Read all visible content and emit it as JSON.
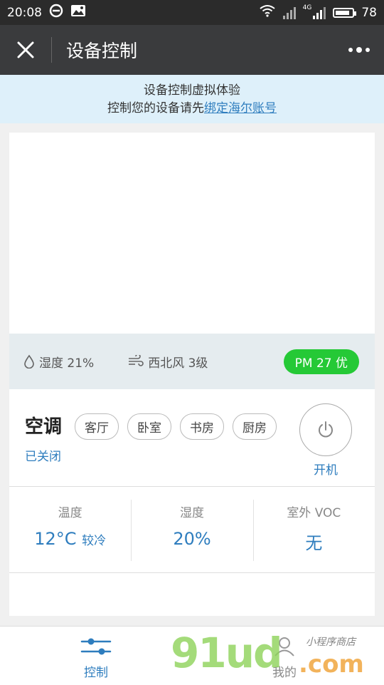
{
  "status_bar": {
    "time": "20:08",
    "battery": "78",
    "network": "4G"
  },
  "header": {
    "title": "设备控制"
  },
  "banner": {
    "line1": "设备控制虚拟体验",
    "line2_prefix": "控制您的设备请先",
    "line2_link": "绑定海尔账号"
  },
  "environment": {
    "humidity": "湿度 21%",
    "wind": "西北风 3级",
    "pm": "PM 27 优"
  },
  "device": {
    "name": "空调",
    "status": "已关闭",
    "rooms": [
      "客厅",
      "卧室",
      "书房",
      "厨房"
    ],
    "power_label": "开机"
  },
  "stats": [
    {
      "label": "温度",
      "value": "12°C",
      "note": "较冷"
    },
    {
      "label": "湿度",
      "value": "20%"
    },
    {
      "label": "室外 VOC",
      "value": "无"
    }
  ],
  "tabbar": {
    "control_label": "控制",
    "mine_label": "我的"
  },
  "watermark": {
    "main": "91ud",
    "suffix": ".com",
    "tag": "小程序商店"
  },
  "colors": {
    "accent": "#2e7dbe",
    "pm_good": "#25c936",
    "titlebar": "#3a3b3d"
  }
}
